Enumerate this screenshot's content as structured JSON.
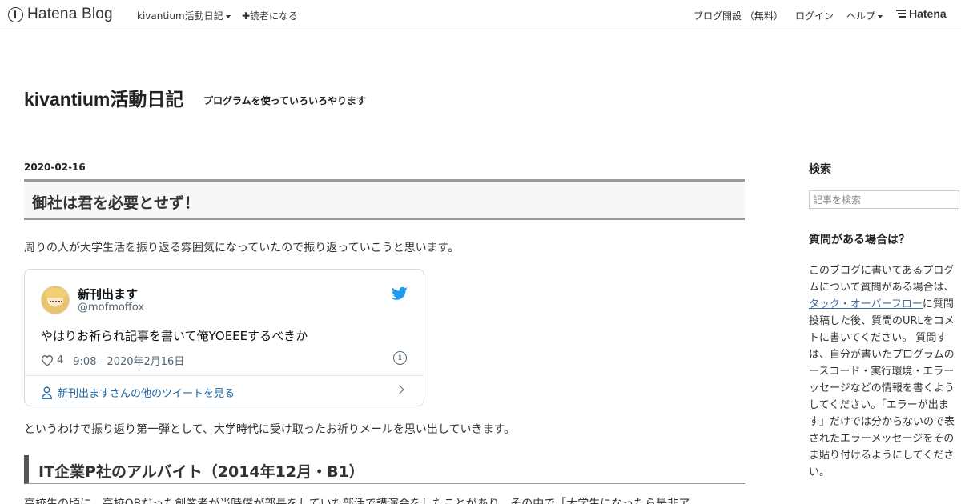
{
  "navbar": {
    "brand": "Hatena Blog",
    "blog_menu": "kivantium活動日記",
    "subscribe": "✚読者になる",
    "start_blog": "ブログ開設 （無料）",
    "login": "ログイン",
    "help": "ヘルプ",
    "hatena": "Hatena"
  },
  "header": {
    "title": "kivantium活動日記",
    "description": "プログラムを使っていろいろやります"
  },
  "entry": {
    "date": "2020-02-16",
    "title": "御社は君を必要とせず！",
    "intro": "周りの人が大学生活を振り返る雰囲気になっていたので振り返っていこうと思います。",
    "tweet": {
      "name": "新刊出ます",
      "handle": "@mofmoffox",
      "text": "やはりお祈られ記事を書いて俺YOEEEするべきか",
      "likes": "4",
      "time": "9:08 - 2020年2月16日",
      "more": "新刊出ますさんの他のツイートを見る"
    },
    "after_tweet": "というわけで振り返り第一弾として、大学時代に受け取ったお祈りメールを思い出していきます。",
    "section_heading": "IT企業P社のアルバイト（2014年12月・B1）",
    "section_text": "高校生の頃に、高校OBだった創業者が当時僕が部長をしていた部活で講演会をしたことがあり、その中で「大学生になったら是非ア"
  },
  "sidebar": {
    "search_heading": "検索",
    "search_placeholder": "記事を検索",
    "question_heading": "質問がある場合は？",
    "question_lines": [
      "このブログに書いてあるプログ",
      "ムについて質問がある場合は、",
      "タック・オーバーフローに質問",
      "投稿した後、質問のURLをコメ",
      "トに書いてください。 質問す",
      "は、自分が書いたプログラムの",
      "ースコード・実行環境・エラー",
      "ッセージなどの情報を書くよう",
      "してください。「エラーが出ま",
      "す」だけでは分からないので表",
      "されたエラーメッセージをその",
      "ま貼り付けるようにしてくださ",
      "い。"
    ],
    "question_link": "タック・オーバーフロー",
    "question_link_suffix": "に質問"
  },
  "colors": {
    "link": "#3d6a9e",
    "twitter_blue": "#1d9bf0",
    "heading_border": "#999999"
  }
}
